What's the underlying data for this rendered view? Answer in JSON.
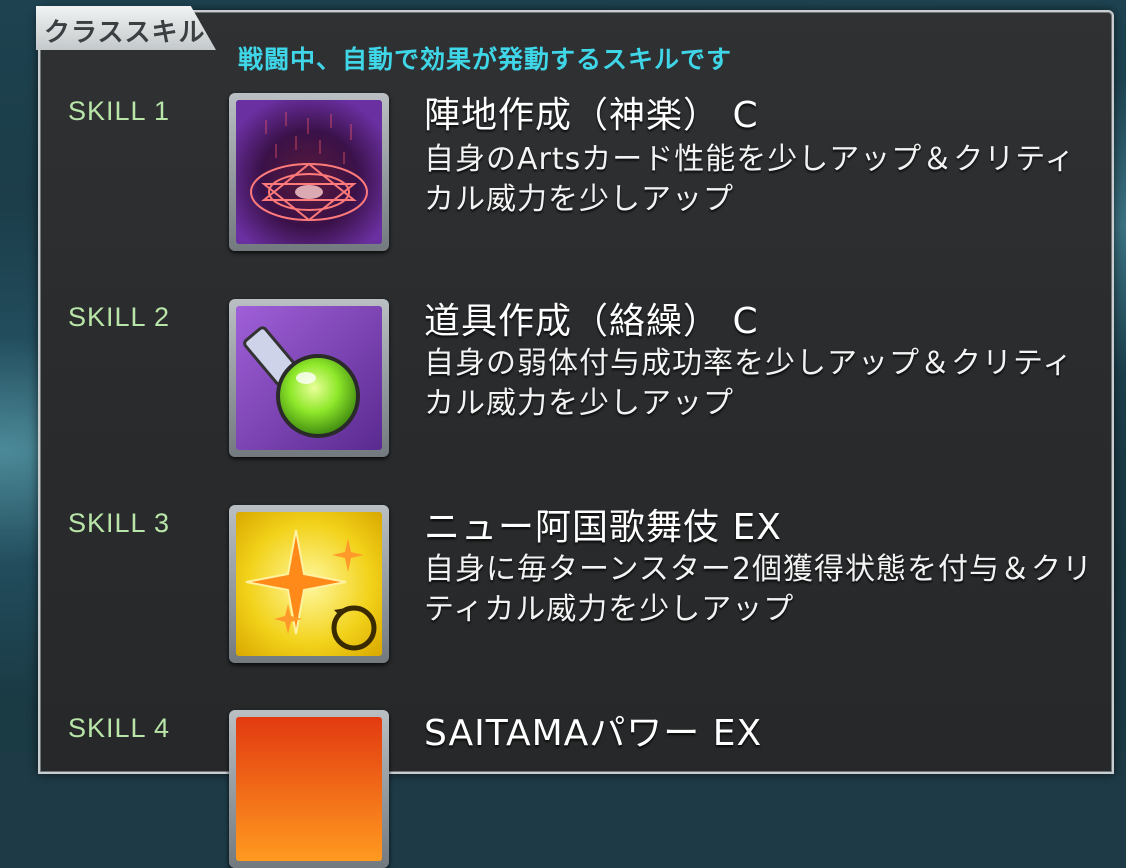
{
  "panel": {
    "tab_title": "クラススキル",
    "subtitle": "戦闘中、自動で効果が発動するスキルです"
  },
  "skills": [
    {
      "label": "SKILL 1",
      "name": "陣地作成（神楽） C",
      "description": "自身のArtsカード性能を少しアップ＆クリティカル威力を少しアップ",
      "icon": "magic-circle-icon"
    },
    {
      "label": "SKILL 2",
      "name": "道具作成（絡繰） C",
      "description": "自身の弱体付与成功率を少しアップ＆クリティカル威力を少しアップ",
      "icon": "potion-flask-icon"
    },
    {
      "label": "SKILL 3",
      "name": "ニュー阿国歌舞伎 EX",
      "description": "自身に毎ターンスター2個獲得状態を付与＆クリティカル威力を少しアップ",
      "icon": "star-gain-icon"
    },
    {
      "label": "SKILL 4",
      "name": "SAITAMAパワー EX",
      "description": "",
      "icon": "power-up-icon"
    }
  ],
  "colors": {
    "subtitle": "#3fd6e8",
    "skill_label": "#b9e6a8",
    "panel_bg": "#2c2e30"
  }
}
